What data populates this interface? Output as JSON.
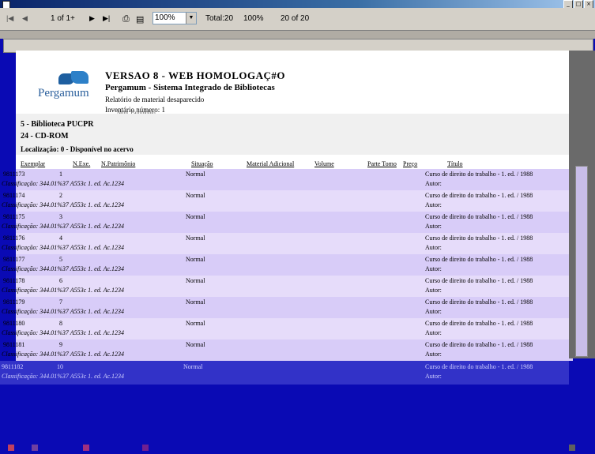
{
  "window": {
    "minimize": "_",
    "restore": "□",
    "close": "×"
  },
  "toolbar": {
    "first": "|◀",
    "prev": "◀",
    "page_indicator": "1 of 1+",
    "next": "▶",
    "last": "▶|",
    "print_icon": "print-icon",
    "export_icon": "export-icon",
    "zoom": "100%",
    "total": "Total:20",
    "percent": "100%",
    "of": "20 of 20"
  },
  "report": {
    "logo": "Pergamum",
    "title": "VERSAO 8 - WEB HOMOLOGAÇ#O",
    "subtitle": "Pergamum - Sistema Integrado de Bibliotecas",
    "description": "Relatório de material desaparecido",
    "inventory": "Inventário número: 1",
    "inventory_sub": "Num. Patrimônio",
    "library": "5 - Biblioteca PUCPR",
    "media": "24 - CD-ROM",
    "location": "Localização: 0 - Disponível no acervo"
  },
  "columns": [
    "Exemplar",
    "N.Exe.",
    "N.Patrimônio",
    "Situação",
    "Material Adicional",
    "Volume",
    "Parte Tomo",
    "Preço",
    "Título"
  ],
  "rows": [
    {
      "exemplar": "9811173",
      "nexe": "1",
      "situacao": "Normal",
      "titulo": "Curso de direito do trabalho - 1. ed. / 1988",
      "classificacao": "Classificação: 344.01%37 A553c 1. ed. Ac.1234",
      "autor": "Autor:"
    },
    {
      "exemplar": "9811174",
      "nexe": "2",
      "situacao": "Normal",
      "titulo": "Curso de direito do trabalho - 1. ed. / 1988",
      "classificacao": "Classificação: 344.01%37 A553c 1. ed. Ac.1234",
      "autor": "Autor:"
    },
    {
      "exemplar": "9811175",
      "nexe": "3",
      "situacao": "Normal",
      "titulo": "Curso de direito do trabalho - 1. ed. / 1988",
      "classificacao": "Classificação: 344.01%37 A553c 1. ed. Ac.1234",
      "autor": "Autor:"
    },
    {
      "exemplar": "9811176",
      "nexe": "4",
      "situacao": "Normal",
      "titulo": "Curso de direito do trabalho - 1. ed. / 1988",
      "classificacao": "Classificação: 344.01%37 A553c 1. ed. Ac.1234",
      "autor": "Autor:"
    },
    {
      "exemplar": "9811177",
      "nexe": "5",
      "situacao": "Normal",
      "titulo": "Curso de direito do trabalho - 1. ed. / 1988",
      "classificacao": "Classificação: 344.01%37 A553c 1. ed. Ac.1234",
      "autor": "Autor:"
    },
    {
      "exemplar": "9811178",
      "nexe": "6",
      "situacao": "Normal",
      "titulo": "Curso de direito do trabalho - 1. ed. / 1988",
      "classificacao": "Classificação: 344.01%37 A553c 1. ed. Ac.1234",
      "autor": "Autor:"
    },
    {
      "exemplar": "9811179",
      "nexe": "7",
      "situacao": "Normal",
      "titulo": "Curso de direito do trabalho - 1. ed. / 1988",
      "classificacao": "Classificação: 344.01%37 A553c 1. ed. Ac.1234",
      "autor": "Autor:"
    },
    {
      "exemplar": "9811180",
      "nexe": "8",
      "situacao": "Normal",
      "titulo": "Curso de direito do trabalho - 1. ed. / 1988",
      "classificacao": "Classificação: 344.01%37 A553c 1. ed. Ac.1234",
      "autor": "Autor:"
    },
    {
      "exemplar": "9811181",
      "nexe": "9",
      "situacao": "Normal",
      "titulo": "Curso de direito do trabalho - 1. ed. / 1988",
      "classificacao": "Classificação: 344.01%37 A553c 1. ed. Ac.1234",
      "autor": "Autor:"
    }
  ],
  "last_row": {
    "exemplar": "9811182",
    "nexe": "10",
    "situacao": "Normal",
    "titulo": "Curso de direito do trabalho - 1. ed. / 1988",
    "classificacao": "Classificação: 344.01%37 A553c 1. ed. Ac.1234",
    "autor": "Autor:"
  },
  "colors": {
    "desktop": "#0a0ab4",
    "row_a": "#d8ccf8",
    "row_b": "#e6dcfa",
    "toolbar": "#d4d0c8"
  }
}
